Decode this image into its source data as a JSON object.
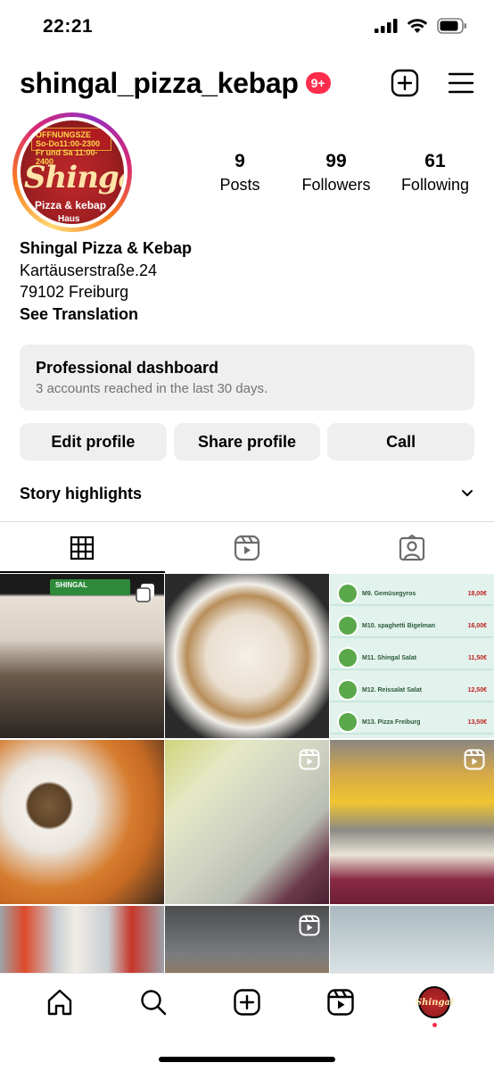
{
  "status_bar": {
    "time": "22:21"
  },
  "header": {
    "username": "shingal_pizza_kebap",
    "notification_badge": "9+"
  },
  "profile": {
    "avatar": {
      "sign_line1": "ÖFFNUNGSZE",
      "sign_line2": "So-Do11:00-2300",
      "sign_line3": "Fr und Sa 11:00-2400",
      "logo_text": "Shingal",
      "sub_text": "Pizza & kebap",
      "sub_text2": "Haus"
    },
    "stats": [
      {
        "value": "9",
        "label": "Posts"
      },
      {
        "value": "99",
        "label": "Followers"
      },
      {
        "value": "61",
        "label": "Following"
      }
    ],
    "bio": {
      "name": "Shingal Pizza & Kebap",
      "line1": "Kartäuserstraße.24",
      "line2": "79102 Freiburg",
      "see_translation": "See Translation"
    }
  },
  "dashboard": {
    "title": "Professional dashboard",
    "subtitle": "3 accounts reached in the last 30 days."
  },
  "buttons": {
    "edit": "Edit profile",
    "share": "Share profile",
    "call": "Call"
  },
  "highlights": {
    "label": "Story highlights"
  },
  "tabs": [
    "grid",
    "reels",
    "tagged"
  ],
  "grid_posts": [
    {
      "type": "carousel",
      "sign": "SHINGAL"
    },
    {
      "type": "photo"
    },
    {
      "type": "photo",
      "menu": [
        {
          "label": "M9. Gemüsegyros",
          "price": "18,00€"
        },
        {
          "label": "M10. spaghetti Bigelman",
          "price": "16,00€"
        },
        {
          "label": "M11. Shingal Salat",
          "price": "11,50€"
        },
        {
          "label": "M12. Reissalat Salat",
          "price": "12,50€"
        },
        {
          "label": "M13. Pizza Freiburg",
          "price": "13,50€"
        }
      ]
    },
    {
      "type": "photo"
    },
    {
      "type": "reel"
    },
    {
      "type": "reel"
    },
    {
      "type": "photo"
    },
    {
      "type": "reel"
    },
    {
      "type": "photo"
    }
  ],
  "bottom_nav": {
    "profile_avatar_text": "Shingal"
  },
  "colors": {
    "badge": "#ff2c4b",
    "button_bg": "#efefef",
    "secondary_text": "#737373"
  }
}
